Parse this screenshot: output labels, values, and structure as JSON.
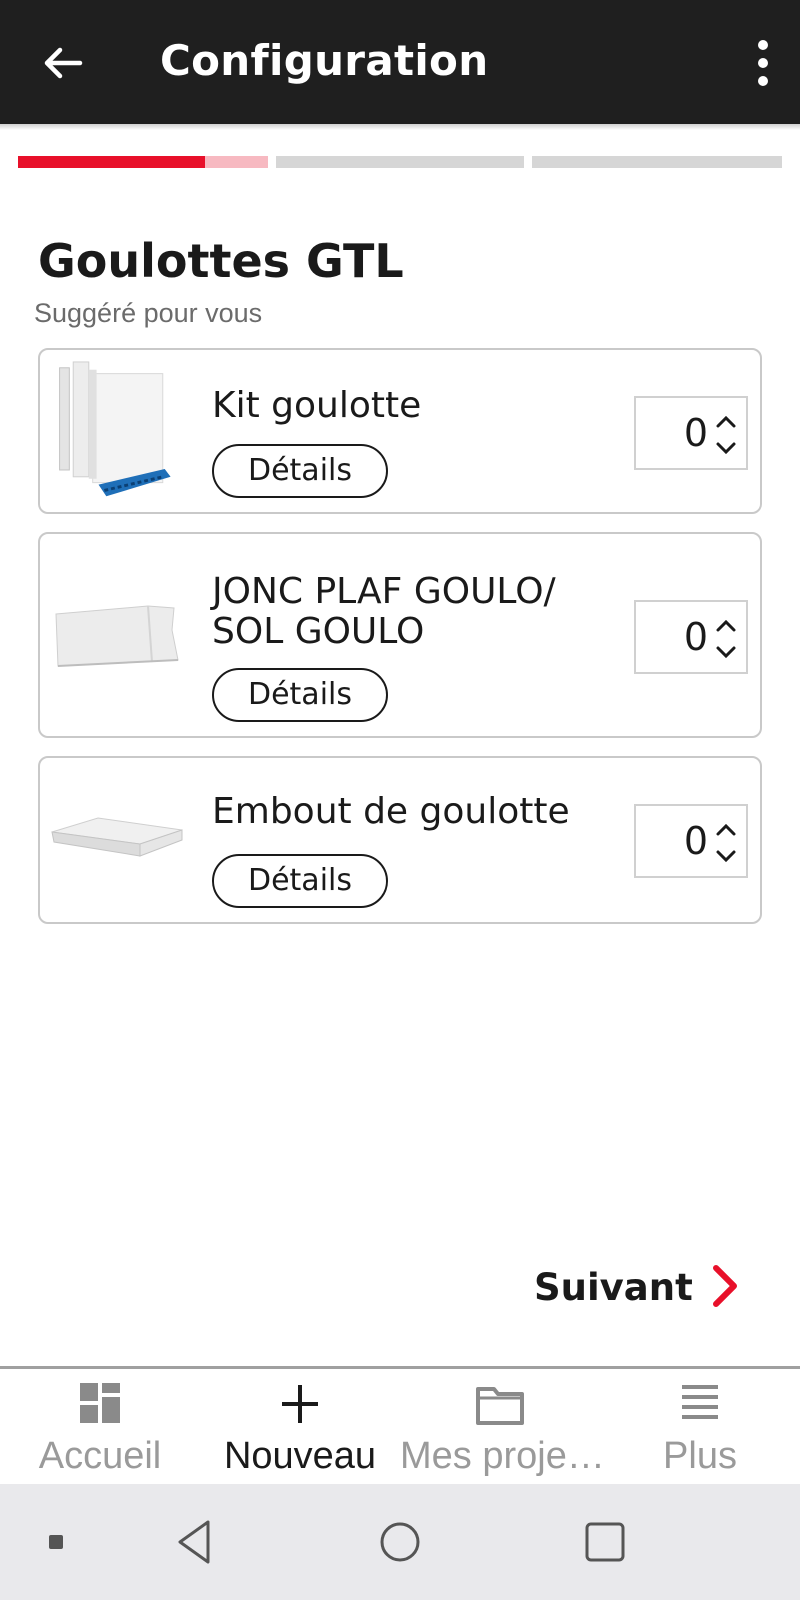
{
  "appbar": {
    "title": "Configuration"
  },
  "progress": {
    "steps": 3,
    "current_step_fraction": 0.75
  },
  "section": {
    "title": "Goulottes GTL",
    "subtitle": "Suggéré pour vous"
  },
  "products": [
    {
      "name": "Kit goulotte",
      "details_label": "Détails",
      "quantity": "0"
    },
    {
      "name_line1": "JONC PLAF GOULO/",
      "name_line2": "SOL GOULO",
      "details_label": "Détails",
      "quantity": "0"
    },
    {
      "name": "Embout de goulotte",
      "details_label": "Détails",
      "quantity": "0"
    }
  ],
  "next": {
    "label": "Suivant"
  },
  "bottomnav": [
    {
      "label": "Accueil",
      "icon": "dashboard-icon"
    },
    {
      "label": "Nouveau",
      "icon": "plus-icon"
    },
    {
      "label": "Mes proje…",
      "icon": "folder-icon"
    },
    {
      "label": "Plus",
      "icon": "menu-icon"
    }
  ],
  "colors": {
    "accent": "#e8102a",
    "appbar": "#1f1f1f"
  }
}
